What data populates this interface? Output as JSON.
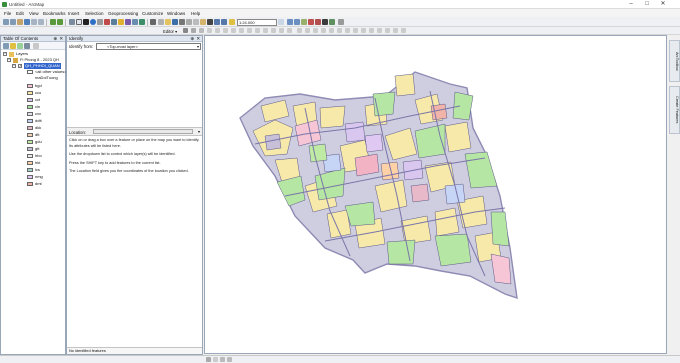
{
  "window": {
    "title": "Untitled - ArcMap"
  },
  "menu": [
    "File",
    "Edit",
    "View",
    "Bookmarks",
    "Insert",
    "Selection",
    "Geoprocessing",
    "Customize",
    "Windows",
    "Help"
  ],
  "toolbar": {
    "scale": "1:24.000",
    "editor_label": "Editor ▾"
  },
  "toc": {
    "title": "Table Of Contents",
    "root_label": "Layers",
    "group_label": "Fi Phong 8 - 2023 QH",
    "layer_label": "QH_PHHOI_QUAN",
    "all_other_values": "<all other values>",
    "field_name": "maDoiTuong",
    "legend": [
      {
        "code": "bgd",
        "color": "#f6c6d6"
      },
      {
        "code": "cco",
        "color": "#f9e7a8"
      },
      {
        "code": "cct",
        "color": "#d9c7f0"
      },
      {
        "code": "cln",
        "color": "#a7e0a0"
      },
      {
        "code": "cxx",
        "color": "#e6e0ec"
      },
      {
        "code": "ddtt",
        "color": "#c6d4f5"
      },
      {
        "code": "dkk",
        "color": "#e8b9c9"
      },
      {
        "code": "dtt",
        "color": "#f3d2b4"
      },
      {
        "code": "gdu",
        "color": "#bfeaa3"
      },
      {
        "code": "gtt",
        "color": "#c8c0d8"
      },
      {
        "code": "hbo",
        "color": "#ececec"
      },
      {
        "code": "hkt",
        "color": "#ffd1a6"
      },
      {
        "code": "lcs",
        "color": "#a4d4cc"
      },
      {
        "code": "nmg",
        "color": "#dfc9f2"
      },
      {
        "code": "dmt",
        "color": "#f2b3a8"
      }
    ]
  },
  "identify": {
    "title": "Identify",
    "from_label": "Identify from:",
    "from_value": "<Top-most layer>",
    "location_label": "Location:",
    "help": [
      "Click on or drag a box over a feature or place on the map you want to identify. Its attributes will be listed here.",
      "Use the dropdown list to control which layer(s) will be identified.",
      "Press the SHIFT key to add features to the current list.",
      "The Location field gives you the coordinates of the location you clicked."
    ],
    "status": "No identified features"
  },
  "right_tabs": [
    "ArcToolbox",
    "Create Features"
  ]
}
